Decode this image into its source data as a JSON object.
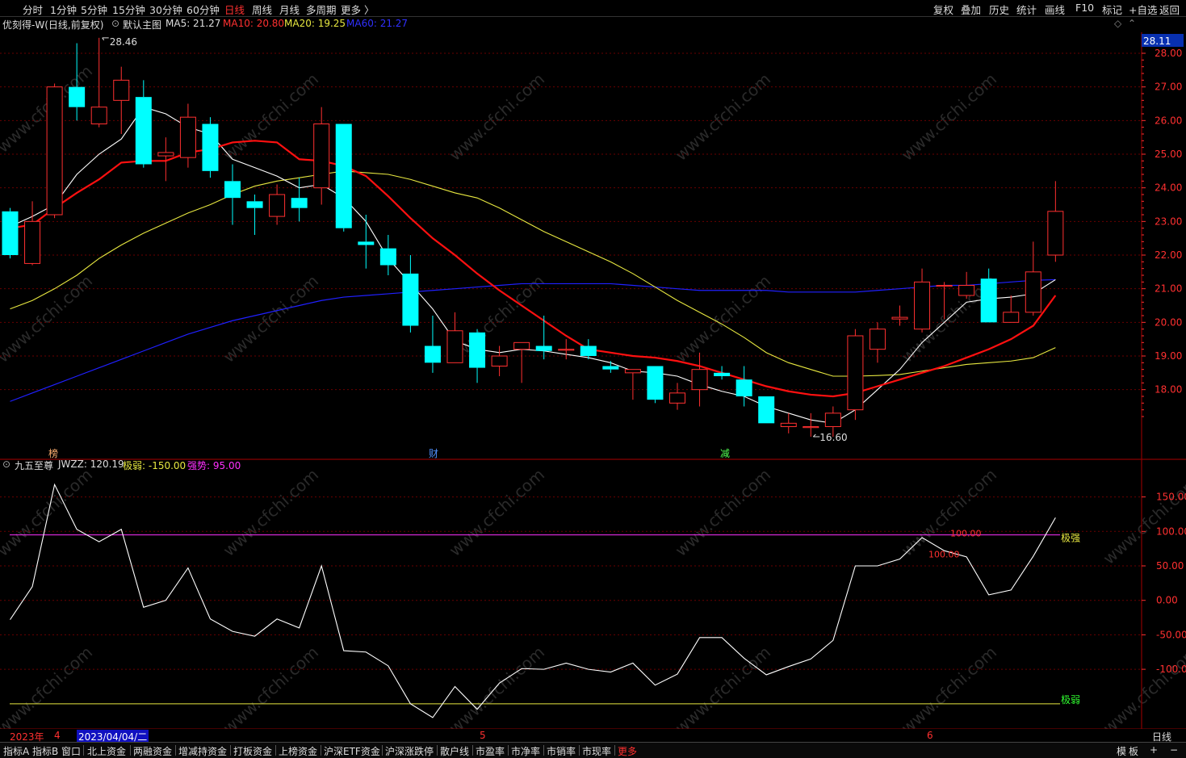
{
  "toolbar": {
    "periods": [
      "分时",
      "1分钟",
      "5分钟",
      "15分钟",
      "30分钟",
      "60分钟",
      "日线",
      "周线",
      "月线",
      "多周期",
      "更多 〉"
    ],
    "active_period": "日线",
    "right_buttons": [
      "复权",
      "叠加",
      "历史",
      "统计",
      "画线",
      "F10",
      "标记",
      "+自选",
      "返回"
    ]
  },
  "main_legend": {
    "title": "优刻得-W(日线,前复权)",
    "template": "默认主图",
    "ma5": "MA5: 21.27",
    "ma10": "MA10: 20.80",
    "ma20": "MA20: 19.25",
    "ma60": "MA60: 21.27"
  },
  "main_axis": {
    "current_price": "28.11",
    "ticks": [
      "28.00",
      "27.00",
      "26.00",
      "25.00",
      "24.00",
      "23.00",
      "22.00",
      "21.00",
      "20.00",
      "19.00",
      "18.00"
    ],
    "high_label": "28.46",
    "low_label": "16.60",
    "markers": [
      "榜",
      "财",
      "减"
    ]
  },
  "indicator_legend": {
    "name": "九五至尊",
    "jwzz": "JWZZ: 120.19",
    "jiruo": "极弱: -150.00",
    "qiangshi": "强势: 95.00"
  },
  "indicator_axis": {
    "ticks": [
      "150.00",
      "100.00",
      "50.00",
      "0.00",
      "-50.00",
      "-100.00"
    ],
    "strong_label": "极强",
    "weak_label": "极弱",
    "value_labels": [
      "100.00",
      "100.00"
    ]
  },
  "date_axis": {
    "labels": [
      "2023年",
      "4",
      "2023/04/04/二",
      "5",
      "6"
    ],
    "period": "日线"
  },
  "watermark": "www.cfchi.com",
  "bottom_tabs": [
    "指标A",
    "指标B",
    "窗口",
    "北上资金",
    "两融资金",
    "增减持资金",
    "打板资金",
    "上榜资金",
    "沪深ETF资金",
    "沪深涨跌停",
    "散户线",
    "市盈率",
    "市净率",
    "市销率",
    "市现率",
    "更多"
  ],
  "bottom_right": [
    "模",
    "板",
    "+",
    "−"
  ],
  "colors": {
    "up": "#ff3030",
    "down": "#00ffff",
    "ma5": "#ffffff",
    "ma10": "#ff1010",
    "ma20": "#e8e840",
    "ma60": "#2020ff",
    "grid": "#6a0000"
  },
  "chart_data": {
    "type": "candlestick",
    "candles": [
      {
        "o": 23.3,
        "h": 23.4,
        "l": 21.9,
        "c": 22.0
      },
      {
        "o": 21.75,
        "h": 23.6,
        "l": 21.7,
        "c": 23.0
      },
      {
        "o": 23.2,
        "h": 27.1,
        "l": 23.1,
        "c": 27.0
      },
      {
        "o": 27.0,
        "h": 28.3,
        "l": 26.0,
        "c": 26.4
      },
      {
        "o": 25.9,
        "h": 28.46,
        "l": 25.8,
        "c": 26.4
      },
      {
        "o": 26.6,
        "h": 27.6,
        "l": 25.6,
        "c": 27.2
      },
      {
        "o": 26.7,
        "h": 27.2,
        "l": 24.6,
        "c": 24.7
      },
      {
        "o": 24.95,
        "h": 25.5,
        "l": 24.2,
        "c": 25.05
      },
      {
        "o": 24.9,
        "h": 26.5,
        "l": 24.6,
        "c": 26.1
      },
      {
        "o": 25.9,
        "h": 26.1,
        "l": 24.3,
        "c": 24.5
      },
      {
        "o": 24.2,
        "h": 24.7,
        "l": 22.9,
        "c": 23.7
      },
      {
        "o": 23.6,
        "h": 23.8,
        "l": 22.6,
        "c": 23.4
      },
      {
        "o": 23.15,
        "h": 24.1,
        "l": 22.9,
        "c": 23.8
      },
      {
        "o": 23.7,
        "h": 24.3,
        "l": 23.0,
        "c": 23.4
      },
      {
        "o": 24.0,
        "h": 26.4,
        "l": 23.5,
        "c": 25.9
      },
      {
        "o": 25.9,
        "h": 25.9,
        "l": 22.7,
        "c": 22.8
      },
      {
        "o": 22.4,
        "h": 23.2,
        "l": 21.6,
        "c": 22.3
      },
      {
        "o": 22.2,
        "h": 22.6,
        "l": 21.4,
        "c": 21.7
      },
      {
        "o": 21.45,
        "h": 22.0,
        "l": 19.7,
        "c": 19.9
      },
      {
        "o": 19.3,
        "h": 20.2,
        "l": 18.5,
        "c": 18.8
      },
      {
        "o": 18.8,
        "h": 20.3,
        "l": 18.8,
        "c": 19.75
      },
      {
        "o": 19.7,
        "h": 19.8,
        "l": 18.2,
        "c": 18.65
      },
      {
        "o": 18.7,
        "h": 19.3,
        "l": 18.4,
        "c": 19.0
      },
      {
        "o": 19.2,
        "h": 19.4,
        "l": 18.2,
        "c": 19.4
      },
      {
        "o": 19.3,
        "h": 20.2,
        "l": 18.9,
        "c": 19.15
      },
      {
        "o": 19.2,
        "h": 19.5,
        "l": 18.9,
        "c": 19.2
      },
      {
        "o": 19.3,
        "h": 19.5,
        "l": 18.9,
        "c": 19.0
      },
      {
        "o": 18.7,
        "h": 18.85,
        "l": 18.5,
        "c": 18.6
      },
      {
        "o": 18.5,
        "h": 18.6,
        "l": 17.7,
        "c": 18.6
      },
      {
        "o": 18.7,
        "h": 18.7,
        "l": 17.6,
        "c": 17.7
      },
      {
        "o": 17.6,
        "h": 18.2,
        "l": 17.4,
        "c": 17.9
      },
      {
        "o": 18.0,
        "h": 19.1,
        "l": 17.5,
        "c": 18.6
      },
      {
        "o": 18.5,
        "h": 18.7,
        "l": 18.3,
        "c": 18.4
      },
      {
        "o": 18.3,
        "h": 18.7,
        "l": 17.5,
        "c": 17.8
      },
      {
        "o": 17.8,
        "h": 17.8,
        "l": 17.0,
        "c": 17.0
      },
      {
        "o": 16.9,
        "h": 17.3,
        "l": 16.7,
        "c": 17.0
      },
      {
        "o": 16.9,
        "h": 17.3,
        "l": 16.6,
        "c": 16.9
      },
      {
        "o": 16.9,
        "h": 17.5,
        "l": 16.6,
        "c": 17.3
      },
      {
        "o": 17.4,
        "h": 19.8,
        "l": 17.1,
        "c": 19.6
      },
      {
        "o": 19.2,
        "h": 20.0,
        "l": 18.8,
        "c": 19.8
      },
      {
        "o": 20.1,
        "h": 20.5,
        "l": 19.9,
        "c": 20.15
      },
      {
        "o": 19.8,
        "h": 21.6,
        "l": 19.7,
        "c": 21.2
      },
      {
        "o": 21.1,
        "h": 21.2,
        "l": 20.1,
        "c": 21.1
      },
      {
        "o": 20.8,
        "h": 21.5,
        "l": 20.7,
        "c": 21.1
      },
      {
        "o": 21.3,
        "h": 21.6,
        "l": 20.0,
        "c": 20.0
      },
      {
        "o": 20.0,
        "h": 20.8,
        "l": 20.0,
        "c": 20.3
      },
      {
        "o": 20.3,
        "h": 22.4,
        "l": 20.2,
        "c": 21.5
      },
      {
        "o": 22.0,
        "h": 24.2,
        "l": 21.8,
        "c": 23.3
      }
    ],
    "ma5": [
      22.85,
      23.15,
      23.5,
      24.4,
      25.0,
      25.45,
      26.4,
      26.2,
      25.8,
      25.6,
      24.85,
      24.6,
      24.35,
      24.0,
      24.1,
      23.7,
      23.0,
      21.9,
      21.15,
      20.4,
      19.45,
      19.2,
      19.1,
      19.2,
      19.15,
      19.05,
      18.95,
      18.8,
      18.55,
      18.5,
      18.4,
      18.15,
      17.95,
      17.8,
      17.5,
      17.3,
      17.1,
      17.0,
      17.4,
      18.0,
      18.6,
      19.4,
      20.0,
      20.6,
      20.7,
      20.75,
      20.85,
      21.27
    ],
    "ma10": [
      22.8,
      22.9,
      23.4,
      23.85,
      24.25,
      24.75,
      24.8,
      24.8,
      25.05,
      25.15,
      25.35,
      25.4,
      25.35,
      24.85,
      24.8,
      24.65,
      24.35,
      23.75,
      23.1,
      22.5,
      22.0,
      21.45,
      20.95,
      20.5,
      20.05,
      19.6,
      19.2,
      19.1,
      19.0,
      18.95,
      18.85,
      18.7,
      18.5,
      18.3,
      18.1,
      17.95,
      17.85,
      17.8,
      17.9,
      18.1,
      18.3,
      18.5,
      18.7,
      18.95,
      19.2,
      19.5,
      19.9,
      20.8
    ],
    "ma20": [
      20.4,
      20.65,
      21.0,
      21.4,
      21.9,
      22.3,
      22.65,
      22.95,
      23.25,
      23.5,
      23.8,
      24.05,
      24.2,
      24.3,
      24.4,
      24.5,
      24.45,
      24.4,
      24.25,
      24.05,
      23.85,
      23.7,
      23.4,
      23.05,
      22.7,
      22.4,
      22.1,
      21.8,
      21.45,
      21.05,
      20.65,
      20.3,
      19.95,
      19.55,
      19.1,
      18.8,
      18.6,
      18.4,
      18.4,
      18.42,
      18.45,
      18.55,
      18.65,
      18.75,
      18.8,
      18.85,
      18.95,
      19.25
    ],
    "ma60": [
      17.65,
      17.9,
      18.15,
      18.4,
      18.65,
      18.9,
      19.15,
      19.4,
      19.65,
      19.85,
      20.05,
      20.2,
      20.35,
      20.5,
      20.65,
      20.75,
      20.8,
      20.85,
      20.9,
      20.95,
      21.0,
      21.05,
      21.1,
      21.15,
      21.15,
      21.15,
      21.15,
      21.15,
      21.1,
      21.05,
      21.0,
      20.95,
      20.95,
      20.95,
      20.95,
      20.9,
      20.9,
      20.9,
      20.9,
      20.95,
      21.0,
      21.05,
      21.1,
      21.1,
      21.15,
      21.2,
      21.25,
      21.27
    ],
    "jwzz": [
      -28,
      20,
      168,
      103,
      85,
      103,
      -10,
      0,
      47,
      -27,
      -45,
      -52,
      -27,
      -40,
      50,
      -73,
      -75,
      -95,
      -150,
      -170,
      -125,
      -158,
      -120,
      -99,
      -100,
      -91,
      -100,
      -104,
      -91,
      -123,
      -107,
      -54,
      -54,
      -84,
      -108,
      -96,
      -85,
      -58,
      50,
      50,
      60,
      91,
      72,
      63,
      8,
      15,
      64,
      120
    ],
    "jiruo": -150,
    "qiangshi": 95,
    "price_range": [
      16.0,
      28.6
    ],
    "indicator_range": [
      -183,
      187
    ]
  }
}
